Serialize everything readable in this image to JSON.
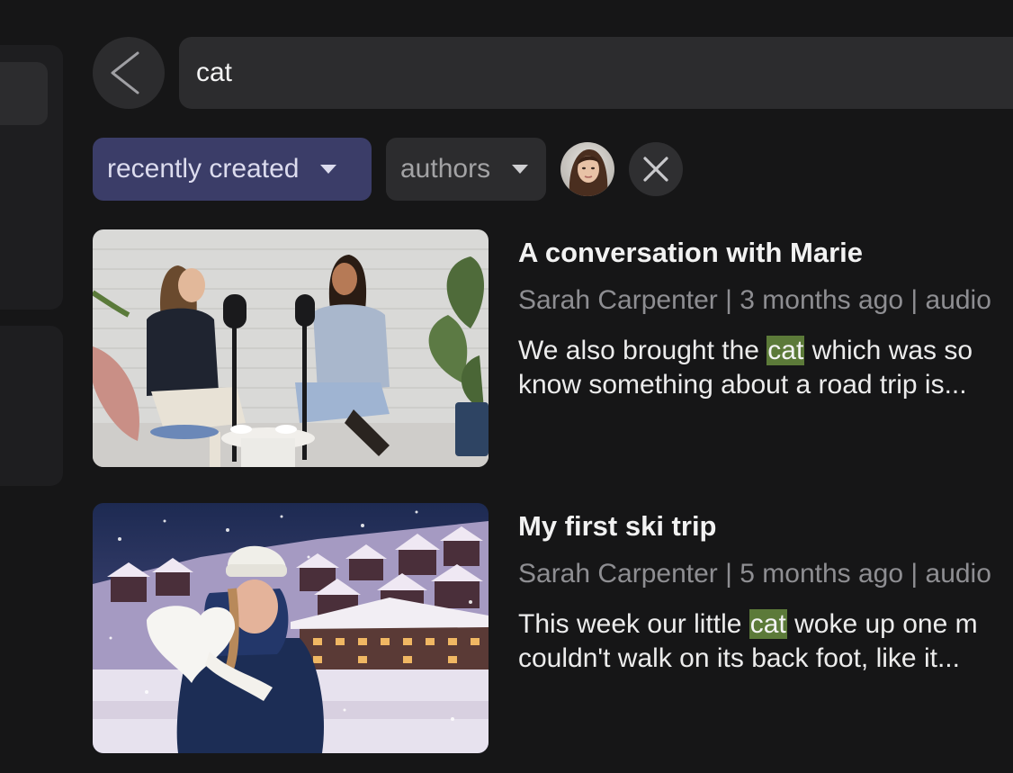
{
  "search": {
    "query": "cat"
  },
  "filters": {
    "sort_label": "recently created",
    "authors_label": "authors"
  },
  "colors": {
    "sort_active": "#3b3d68",
    "highlight": "#5c7a39",
    "surface": "#2c2c2e",
    "background": "#161617"
  },
  "icons": {
    "back": "chevron-left-icon",
    "clear": "close-icon",
    "dropdown": "caret-down-icon"
  },
  "results": [
    {
      "title": "A conversation with Marie",
      "meta": "Sarah Carpenter | 3 months ago | audio",
      "snippet_line1_before": "We also brought the ",
      "snippet_highlight": "cat",
      "snippet_line1_after": " which was so",
      "snippet_line2": "know something about a road trip is..."
    },
    {
      "title": "My first ski trip",
      "meta": "Sarah Carpenter | 5 months ago | audio",
      "snippet_line1_before": "This week our little ",
      "snippet_highlight": "cat",
      "snippet_line1_after": " woke up one m",
      "snippet_line2": "couldn't walk on its back foot, like it..."
    }
  ]
}
